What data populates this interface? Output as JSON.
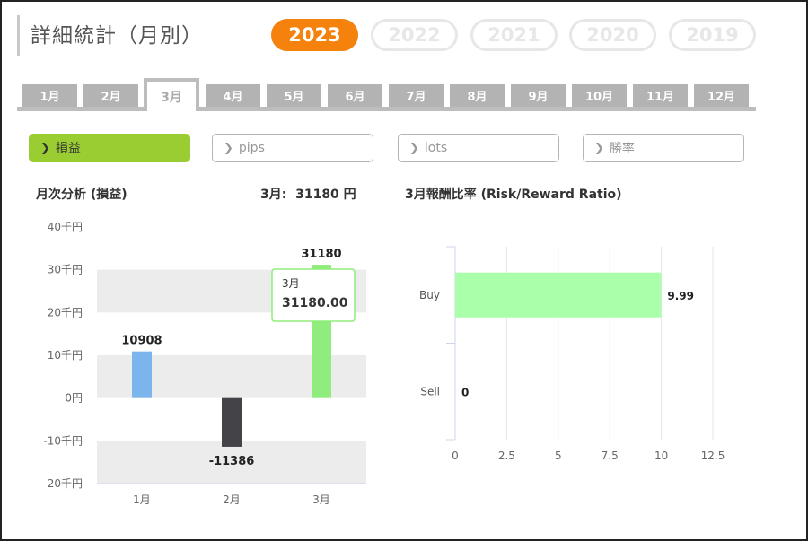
{
  "header": {
    "title": "詳細統計（月別）"
  },
  "years": [
    "2023",
    "2022",
    "2021",
    "2020",
    "2019"
  ],
  "active_year": "2023",
  "months": [
    "1月",
    "2月",
    "3月",
    "4月",
    "5月",
    "6月",
    "7月",
    "8月",
    "9月",
    "10月",
    "11月",
    "12月"
  ],
  "active_month": "3月",
  "metrics": [
    {
      "label": "損益",
      "active": true
    },
    {
      "label": "pips",
      "active": false
    },
    {
      "label": "lots",
      "active": false
    },
    {
      "label": "勝率",
      "active": false
    }
  ],
  "monthly_panel": {
    "heading": "月次分析 (損益)",
    "summary_month": "3月:",
    "summary_value": "31180 円",
    "tooltip": {
      "month": "3月",
      "value": "31180.00"
    }
  },
  "ratio_panel": {
    "heading": "3月報酬比率 (Risk/Reward Ratio)"
  },
  "colors": {
    "accent": "#f5820d",
    "metric_active": "#9acd32",
    "jan_bar": "#7cb5ec",
    "feb_bar": "#434348",
    "mar_bar": "#90ed7d",
    "buy_bar": "#aaffaa"
  },
  "chart_data": [
    {
      "type": "bar",
      "categories": [
        "1月",
        "2月",
        "3月"
      ],
      "values": [
        10908,
        -11386,
        31180
      ],
      "value_labels": [
        "10908",
        "-11386",
        "31180"
      ],
      "bar_colors": [
        "#7cb5ec",
        "#434348",
        "#90ed7d"
      ],
      "ylim": [
        -20000,
        40000
      ],
      "yticks": [
        40000,
        30000,
        20000,
        10000,
        0,
        -10000,
        -20000
      ],
      "ytick_labels": [
        "40千円",
        "30千円",
        "20千円",
        "10千円",
        "0円",
        "-10千円",
        "-20千円"
      ],
      "xlabel": "",
      "ylabel": "",
      "grid": "alternating bands"
    },
    {
      "type": "bar",
      "orientation": "horizontal",
      "categories": [
        "Buy",
        "Sell"
      ],
      "values": [
        9.99,
        0
      ],
      "value_labels": [
        "9.99",
        "0"
      ],
      "xlim": [
        0,
        12.5
      ],
      "xticks": [
        0,
        2.5,
        5,
        7.5,
        10,
        12.5
      ],
      "xtick_labels": [
        "0",
        "2.5",
        "5",
        "7.5",
        "10",
        "12.5"
      ],
      "xlabel": "",
      "ylabel": "",
      "grid": true
    }
  ]
}
